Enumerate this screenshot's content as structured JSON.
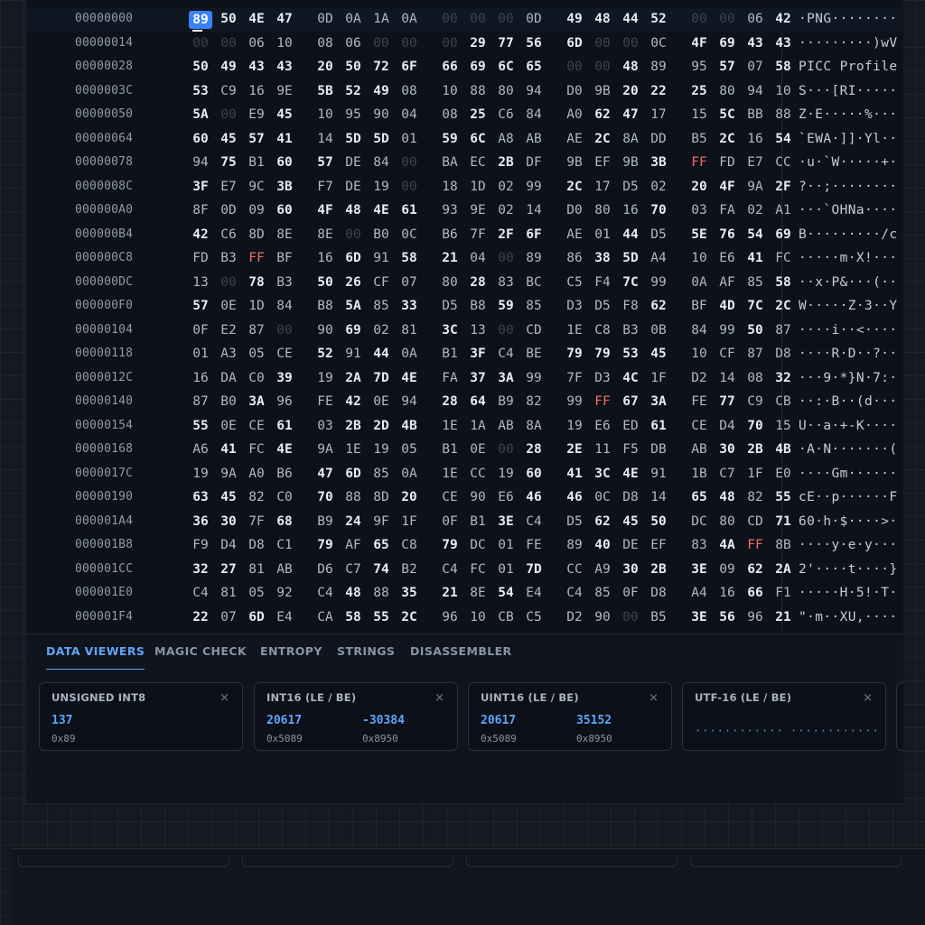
{
  "offsets": [
    "00000000",
    "00000014",
    "00000028",
    "0000003C",
    "00000050",
    "00000064",
    "00000078",
    "0000008C",
    "000000A0",
    "000000B4",
    "000000C8",
    "000000DC",
    "000000F0",
    "00000104",
    "00000118",
    "0000012C",
    "00000140",
    "00000154",
    "00000168",
    "0000017C",
    "00000190",
    "000001A4",
    "000001B8",
    "000001CC",
    "000001E0",
    "000001F4"
  ],
  "hex_rows": [
    "89 50 4E 47 0D 0A 1A 0A 00 00 00 0D 49 48 44 52 00 00 06 42",
    "00 00 06 10 08 06 00 00 00 29 77 56 6D 00 00 0C 4F 69 43 43",
    "50 49 43 43 20 50 72 6F 66 69 6C 65 00 00 48 89 95 57 07 58",
    "53 C9 16 9E 5B 52 49 08 10 88 80 94 D0 9B 20 22 25 80 94 10",
    "5A 00 E9 45 10 95 90 04 08 25 C6 84 A0 62 47 17 15 5C BB 88",
    "60 45 57 41 14 5D 5D 01 59 6C A8 AB AE 2C 8A DD B5 2C 16 54",
    "94 75 B1 60 57 DE 84 00 BA EC 2B DF 9B EF 9B 3B FF FD E7 CC",
    "3F E7 9C 3B F7 DE 19 00 18 1D 02 99 2C 17 D5 02 20 4F 9A 2F",
    "8F 0D 09 60 4F 48 4E 61 93 9E 02 14 D0 80 16 70 03 FA 02 A1",
    "42 C6 8D 8E 8E 00 B0 0C B6 7F 2F 6F AE 01 44 D5 5E 76 54 69",
    "FD B3 FF BF 16 6D 91 58 21 04 00 89 86 38 5D A4 10 E6 41 FC",
    "13 00 78 B3 50 26 CF 07 80 28 83 BC C5 F4 7C 99 0A AF 85 58",
    "57 0E 1D 84 B8 5A 85 33 D5 B8 59 85 D3 D5 F8 62 BF 4D 7C 2C",
    "0F E2 87 00 90 69 02 81 3C 13 00 CD 1E C8 B3 0B 84 99 50 87",
    "01 A3 05 CE 52 91 44 0A B1 3F C4 BE 79 79 53 45 10 CF 87 D8",
    "16 DA C0 39 19 2A 7D 4E FA 37 3A 99 7F D3 4C 1F D2 14 08 32",
    "87 B0 3A 96 FE 42 0E 94 28 64 B9 82 99 FF 67 3A FE 77 C9 CB",
    "55 0E CE 61 03 2B 2D 4B 1E 1A AB 8A 19 E6 ED 61 CE D4 70 15",
    "A6 41 FC 4E 9A 1E 19 05 B1 0E 00 28 2E 11 F5 DB AB 30 2B 4B",
    "19 9A A0 B6 47 6D 85 0A 1E CC 19 60 41 3C 4E 91 1B C7 1F E0",
    "63 45 82 C0 70 88 8D 20 CE 90 E6 46 46 0C D8 14 65 48 82 55",
    "36 30 7F 68 B9 24 9F 1F 0F B1 3E C4 D5 62 45 50 DC 80 CD 71",
    "F9 D4 D8 C1 79 AF 65 C8 79 DC 01 FE 89 40 DE EF 83 4A FF 8B",
    "32 27 81 AB D6 C7 74 B2 C4 FC 01 7D CC A9 30 2B 3E 09 62 2A",
    "C4 81 05 92 C4 48 88 35 21 8E 54 E4 C4 85 0F D8 A4 16 66 F1",
    "22 07 6D E4 CA 58 55 2C 96 10 CB C5 D2 90 00 B5 3E 56 96 21"
  ],
  "ascii_rows": [
    "·PNG········",
    "·········)wV",
    "PICC Profile",
    "S···[RI·····",
    "Z·E·····%···",
    "`EWA·]]·Yl··",
    "·u·`W·····+·",
    "?··;········",
    "···`OHNa····",
    "B·········/c",
    "·····m·X!···",
    "··x·P&···(··",
    "W·····Z·3··Y",
    "····i··<····",
    "····R·D··?··",
    "···9·*}N·7:·",
    "··:·B··(d···",
    "U··a·+-K····",
    "·A·N·······(",
    "····Gm······",
    "cE··p······F",
    "60·h·$····>·",
    "····y·e·y···",
    "2'····t····}",
    "·····H·5!·T·",
    "\"·m··XU,····"
  ],
  "selected_byte": "89",
  "tabs": [
    {
      "label": "DATA VIEWERS",
      "name": "tab-data-viewers",
      "active": true
    },
    {
      "label": "MAGIC CHECK",
      "name": "tab-magic-check",
      "active": false
    },
    {
      "label": "ENTROPY",
      "name": "tab-entropy",
      "active": false
    },
    {
      "label": "STRINGS",
      "name": "tab-strings",
      "active": false
    },
    {
      "label": "DISASSEMBLER",
      "name": "tab-disassembler",
      "active": false
    }
  ],
  "viewers": [
    {
      "title": "UNSIGNED INT8",
      "name": "uint8",
      "values": [
        {
          "value": "137",
          "hex": "0x89"
        }
      ]
    },
    {
      "title": "INT16 (LE / BE)",
      "name": "int16",
      "values": [
        {
          "value": "20617",
          "hex": "0x5089"
        },
        {
          "value": "-30384",
          "hex": "0x8950"
        }
      ]
    },
    {
      "title": "UINT16 (LE / BE)",
      "name": "uint16",
      "values": [
        {
          "value": "20617",
          "hex": "0x5089"
        },
        {
          "value": "35152",
          "hex": "0x8950"
        }
      ]
    },
    {
      "title": "UTF-16 (LE / BE)",
      "name": "utf16",
      "dots": [
        "············",
        "············"
      ]
    }
  ],
  "close_glyph": "×",
  "colors": {
    "accent": "#3b82f6",
    "accent_text": "#60a5fa",
    "ff_byte": "#f26b66",
    "zero_byte": "#3b4453"
  }
}
